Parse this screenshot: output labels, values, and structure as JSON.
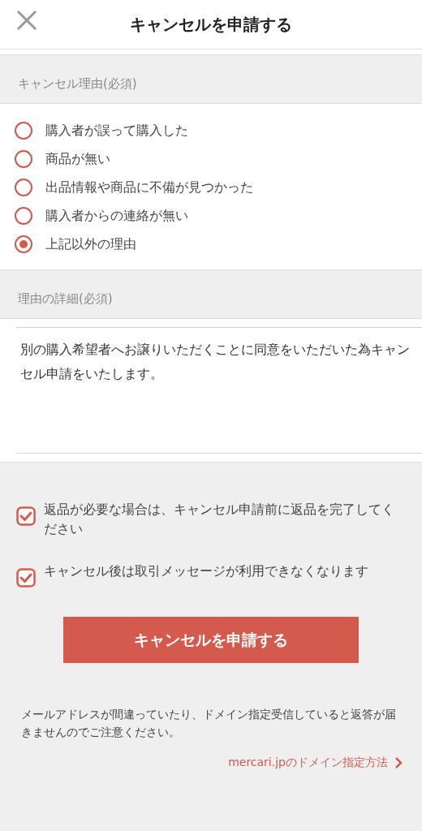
{
  "header": {
    "title": "キャンセルを申請する"
  },
  "reason_section": {
    "label": "キャンセル理由(必須)",
    "options": [
      {
        "label": "購入者が誤って購入した",
        "selected": false
      },
      {
        "label": "商品が無い",
        "selected": false
      },
      {
        "label": "出品情報や商品に不備が見つかった",
        "selected": false
      },
      {
        "label": "購入者からの連絡が無い",
        "selected": false
      },
      {
        "label": "上記以外の理由",
        "selected": true
      }
    ]
  },
  "detail_section": {
    "label": "理由の詳細(必須)",
    "value": "別の購入希望者へお譲りいただくことに同意をいただいた為キャンセル申請をいたします。"
  },
  "confirmations": [
    {
      "label": "返品が必要な場合は、キャンセル申請前に返品を完了してください",
      "checked": true
    },
    {
      "label": "キャンセル後は取引メッセージが利用できなくなります",
      "checked": true
    }
  ],
  "submit_button": "キャンセルを申請する",
  "notice": "メールアドレスが間違っていたり、ドメイン指定受信していると返答が届きませんのでご注意ください。",
  "help_link": "mercari.jpのドメイン指定方法"
}
